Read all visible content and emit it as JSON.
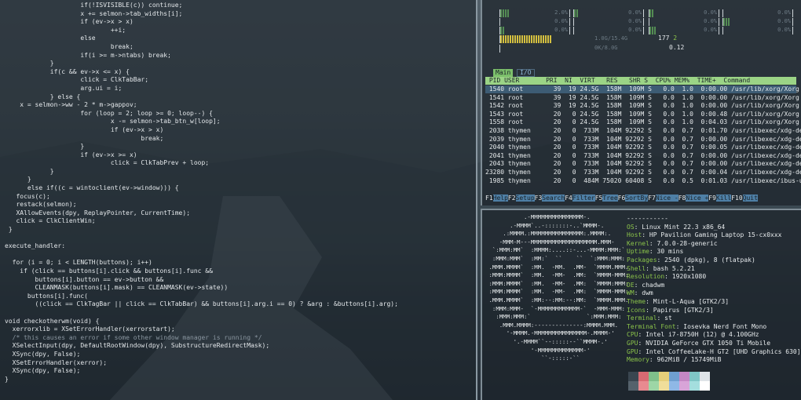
{
  "editor": {
    "lines": [
      {
        "t": "                    if(!ISVISIBLE(c)) continue;"
      },
      {
        "t": "                    x += selmon->tab_widths[i];"
      },
      {
        "t": "                    if (ev->x > x)"
      },
      {
        "t": "                            ++i;"
      },
      {
        "t": "                    else"
      },
      {
        "t": "                            break;"
      },
      {
        "t": "                    if(i >= m->ntabs) break;"
      },
      {
        "t": "            }"
      },
      {
        "t": "            if(c && ev->x <= x) {"
      },
      {
        "t": "                    click = ClkTabBar;"
      },
      {
        "t": "                    arg.ui = i;"
      },
      {
        "t": "            } else {"
      },
      {
        "t": "    x = selmon->ww - 2 * m->gappov;"
      },
      {
        "t": "                    for (loop = 2; loop >= 0; loop--) {"
      },
      {
        "t": "                            x -= selmon->tab_btn_w[loop];"
      },
      {
        "t": "                            if (ev->x > x)"
      },
      {
        "t": "                                    break;"
      },
      {
        "t": "                    }"
      },
      {
        "t": "                    if (ev->x >= x)"
      },
      {
        "t": "                            click = ClkTabPrev + loop;"
      },
      {
        "t": "            }"
      },
      {
        "t": "      }"
      },
      {
        "t": "      else if((c = wintoclient(ev->window))) {"
      },
      {
        "t": "   focus(c);"
      },
      {
        "t": "   restack(selmon);"
      },
      {
        "t": "   XAllowEvents(dpy, ReplayPointer, CurrentTime);"
      },
      {
        "t": "   click = ClkClientWin;"
      },
      {
        "t": " }"
      },
      {
        "t": ""
      },
      {
        "t": "execute_handler:"
      },
      {
        "t": ""
      },
      {
        "t": "  for (i = 0; i < LENGTH(buttons); i++)"
      },
      {
        "t": "    if (click == buttons[i].click && buttons[i].func &&"
      },
      {
        "t": "        buttons[i].button == ev->button &&"
      },
      {
        "t": "        CLEANMASK(buttons[i].mask) == CLEANMASK(ev->state))"
      },
      {
        "t": "      buttons[i].func("
      },
      {
        "t": "        ((click == ClkTagBar || click == ClkTabBar) && buttons[i].arg.i == 0) ? &arg : &buttons[i].arg);"
      },
      {
        "t": ""
      },
      {
        "t": "void checkotherwm(void) {"
      },
      {
        "t": "  xerrorxlib = XSetErrorHandler(xerrorstart);"
      },
      {
        "t": "  /* this causes an error if some other window manager is running */",
        "c": true
      },
      {
        "t": "  XSelectInput(dpy, DefaultRootWindow(dpy), SubstructureRedirectMask);"
      },
      {
        "t": "  XSync(dpy, False);"
      },
      {
        "t": "  XSetErrorHandler(xerror);"
      },
      {
        "t": "  XSync(dpy, False);"
      },
      {
        "t": "}"
      }
    ]
  },
  "htop": {
    "cpu_bars": [
      {
        "label": "[||",
        "val": "2.0%",
        "fill": 0.12
      },
      {
        "label": "[|",
        "val": "0.0%",
        "fill": 0.06
      },
      {
        "label": "[|",
        "val": "0.0%",
        "fill": 0.06
      },
      {
        "label": "[",
        "val": "0.0%",
        "fill": 0.0
      },
      {
        "label": "[",
        "val": "0.0%",
        "fill": 0.0
      },
      {
        "label": "[",
        "val": "0.0%",
        "fill": 0.0
      },
      {
        "label": "[",
        "val": "0.0%",
        "fill": 0.0
      },
      {
        "label": "[||",
        "val": "0.0%",
        "fill": 0.1
      },
      {
        "label": "[|",
        "val": "0.0%",
        "fill": 0.06
      },
      {
        "label": "[",
        "val": "0.0%",
        "fill": 0.0
      },
      {
        "label": "[||",
        "val": "0.0%",
        "fill": 0.1
      },
      {
        "label": "[",
        "val": "0.0%",
        "fill": 0.0
      }
    ],
    "mem_val": "1.0G/15.4G",
    "swp_val": "0K/8.0G",
    "tasks_count": "177",
    "thr": "2",
    "load": "0.12",
    "tab_main": "Main",
    "tab_io": "I/O",
    "header": " PID USER       PRI  NI  VIRT   RES   SHR S  CPU% MEM%  TIME+  Command",
    "processes": [
      " 1540 root        39  19 24.5G  158M  109M S   0.0  1.0  0:00.00 /usr/lib/xorg/Xorg -core :",
      " 1541 root        39  19 24.5G  158M  109M S   0.0  1.0  0:00.00 /usr/lib/xorg/Xorg -core :",
      " 1542 root        39  19 24.5G  158M  109M S   0.0  1.0  0:00.00 /usr/lib/xorg/Xorg -core :",
      " 1543 root        20   0 24.5G  158M  109M S   0.0  1.0  0:00.48 /usr/lib/xorg/Xorg -core :",
      " 1558 root        20   0 24.5G  158M  109M S   0.0  1.0  0:04.03 /usr/lib/xorg/Xorg -core :",
      " 2038 thymen      20   0  733M  104M 92292 S   0.0  0.7  0:01.70 /usr/libexec/xdg-desktop-p",
      " 2039 thymen      20   0  733M  104M 92292 S   0.0  0.7  0:00.00 /usr/libexec/xdg-desktop-p",
      " 2040 thymen      20   0  733M  104M 92292 S   0.0  0.7  0:00.05 /usr/libexec/xdg-desktop-p",
      " 2041 thymen      20   0  733M  104M 92292 S   0.0  0.7  0:00.00 /usr/libexec/xdg-desktop-p",
      " 2043 thymen      20   0  733M  104M 92292 S   0.0  0.7  0:00.00 /usr/libexec/xdg-desktop-p",
      "23280 thymen      20   0  733M  104M 92292 S   0.0  0.7  0:00.04 /usr/libexec/xdg-desktop-p",
      " 1985 thymen      20   0  484M 75020 60408 S   0.0  0.5  0:01.03 /usr/libexec/ibus-ui-gtk3"
    ],
    "fkeys": [
      {
        "k": "F1",
        "l": "Help"
      },
      {
        "k": "F2",
        "l": "Setup"
      },
      {
        "k": "F3",
        "l": "Search"
      },
      {
        "k": "F4",
        "l": "Filter"
      },
      {
        "k": "F5",
        "l": "Tree"
      },
      {
        "k": "F6",
        "l": "SortBy"
      },
      {
        "k": "F7",
        "l": "Nice -"
      },
      {
        "k": "F8",
        "l": "Nice +"
      },
      {
        "k": "F9",
        "l": "Kill"
      },
      {
        "k": "F10",
        "l": "Quit"
      }
    ]
  },
  "neofetch": {
    "ascii": [
      "           .-MMMMMMMMMMMMMMM-.",
      "       .-MMMM`..-:::::::-..`MMMM-.",
      "     .:MMMM.:MMMMMMMMMMMMMMM:.MMMM:.",
      "    -MMM-M---MMMMMMMMMMMMMMMMMMM.MMM-",
      "  `:MMM:MM`  :MMMM:....::-...-MMMM:MMM:`",
      "  :MMM:MMM`  :MM:`  ``    ``  `:MMM:MMM:",
      " .MMM.MMMM`  :MM.  -MM.  .MM-  `MMMM.MMM.",
      " :MMM:MMMM`  :MM.  -MM-  .MM:  `MMMM-MMM:",
      " :MMM:MMMM`  :MM.  -MM-  .MM:  `MMMM:MMM:",
      " :MMM:MMMM`  :MM.  -MM-  .MM:  `MMMM-MMM:",
      " .MMM.MMMM`  :MM:--:MM:--:MM:  `MMMM.MMM.",
      "  :MMM:MMM-  `-MMMMMMMMMMMM-`  -MMM-MMM:",
      "   :MMM:MMM:`                `:MMM:MMM:",
      "    .MMM.MMMM:--------------:MMMM.MMM.",
      "      '-MMMM.-MMMMMMMMMMMMMMM-.MMMM-'",
      "        '.-MMMM``--:::::--``MMMM-.'",
      "             '-MMMMMMMMMMMMM-'",
      "                ``-:::::-``"
    ],
    "rule": "-----------",
    "info": [
      {
        "k": "OS",
        "v": "Linux Mint 22.3 x86_64"
      },
      {
        "k": "Host",
        "v": "HP Pavilion Gaming Laptop 15-cx0xxx"
      },
      {
        "k": "Kernel",
        "v": "7.0.0-28-generic"
      },
      {
        "k": "Uptime",
        "v": "30 mins"
      },
      {
        "k": "Packages",
        "v": "2540 (dpkg), 8 (flatpak)"
      },
      {
        "k": "Shell",
        "v": "bash 5.2.21"
      },
      {
        "k": "Resolution",
        "v": "1920x1080"
      },
      {
        "k": "DE",
        "v": "chadwm"
      },
      {
        "k": "WM",
        "v": "dwm"
      },
      {
        "k": "Theme",
        "v": "Mint-L-Aqua [GTK2/3]"
      },
      {
        "k": "Icons",
        "v": "Papirus [GTK2/3]"
      },
      {
        "k": "Terminal",
        "v": "st"
      },
      {
        "k": "Terminal Font",
        "v": "Iosevka Nerd Font Mono"
      },
      {
        "k": "CPU",
        "v": "Intel i7-8750H (12) @ 4.100GHz"
      },
      {
        "k": "GPU",
        "v": "NVIDIA GeForce GTX 1050 Ti Mobile"
      },
      {
        "k": "GPU",
        "v": "Intel CoffeeLake-H GT2 [UHD Graphics 630]"
      },
      {
        "k": "Memory",
        "v": "962MiB / 15749MiB"
      }
    ],
    "swatches": [
      "#3a4650",
      "#d86a72",
      "#7fbf8a",
      "#e6cf7a",
      "#6f9fd0",
      "#c487c4",
      "#7fc6c6",
      "#dfe4e8",
      "#55626c",
      "#e88a90",
      "#9dd6a6",
      "#f0de9a",
      "#8fb8e6",
      "#d8a4d8",
      "#a4dede",
      "#ffffff"
    ]
  }
}
